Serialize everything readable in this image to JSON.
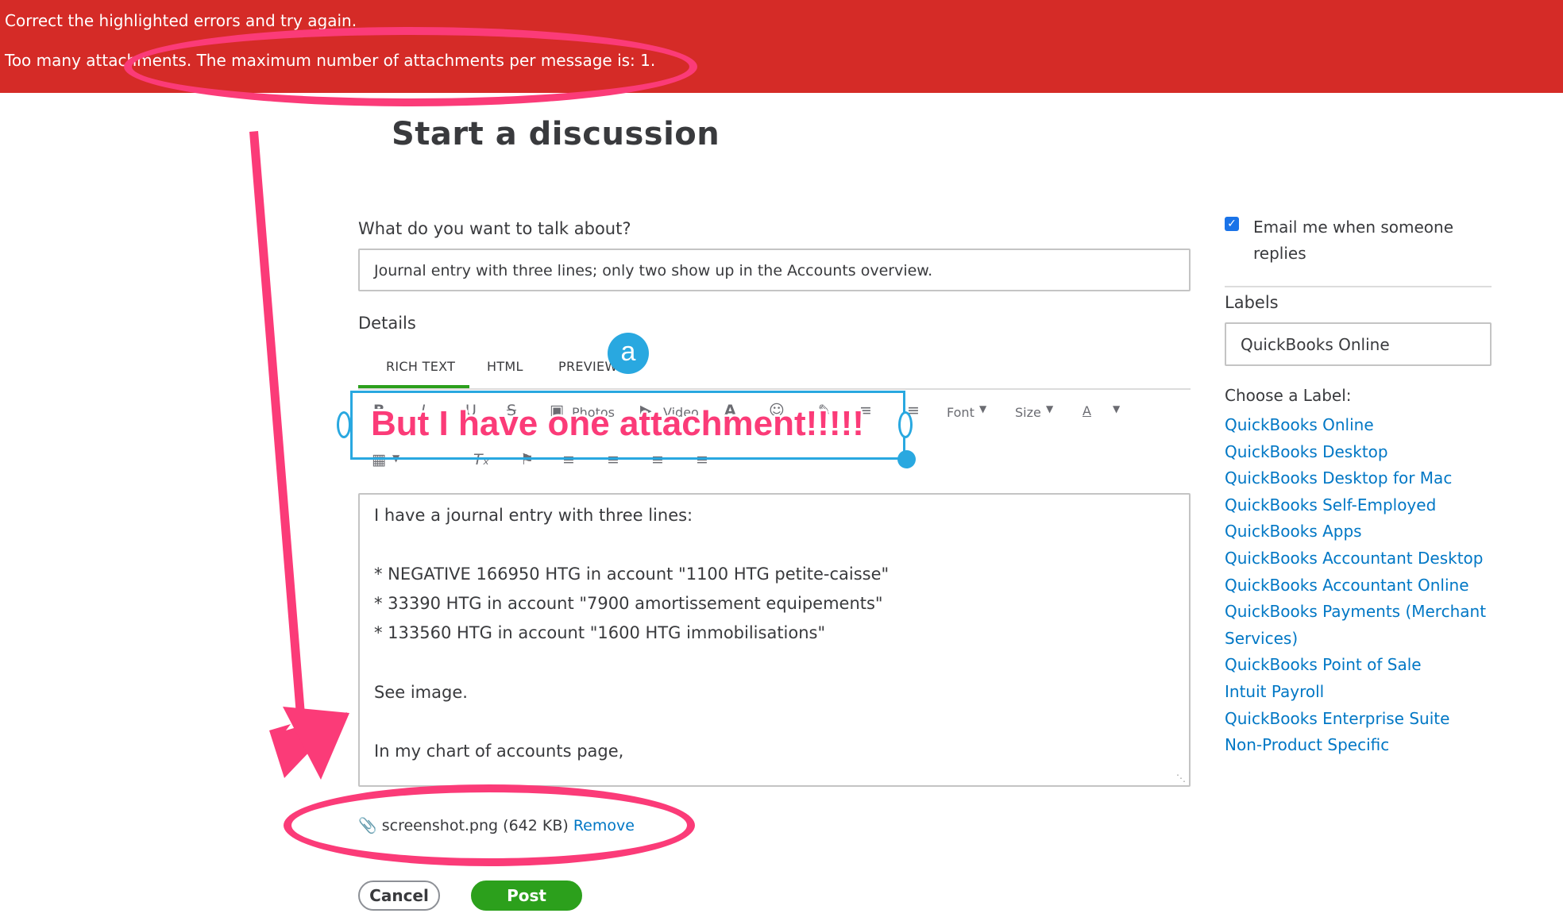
{
  "banner": {
    "line1": "Correct the highlighted errors and try again.",
    "line2": "Too many attachments. The maximum number of attachments per message is: 1."
  },
  "page": {
    "title": "Start a discussion"
  },
  "form": {
    "subject_label": "What do you want to talk about?",
    "subject_value": "Journal entry with three lines; only two show up in the Accounts overview.",
    "details_label": "Details",
    "tabs": [
      "RICH TEXT",
      "HTML",
      "PREVIEW"
    ],
    "active_tab": "RICH TEXT",
    "toolbar": {
      "photos_label": "Photos",
      "video_label": "Video",
      "font_label": "Font",
      "size_label": "Size",
      "color_label": "A"
    },
    "details_lines": [
      "I have a journal entry with three lines:",
      "* NEGATIVE 166950 HTG in account \"1100 HTG petite-caisse\"",
      "* 33390 HTG in account \"7900 amortissement equipements\"",
      "* 133560 HTG in account \"1600 HTG immobilisations\"",
      "See image.",
      "In my chart of accounts page,"
    ],
    "attachment": {
      "filename": "screenshot.png",
      "size": "(642 KB)",
      "remove_label": "Remove"
    },
    "cancel_label": "Cancel",
    "post_label": "Post"
  },
  "sidebar": {
    "email_checkbox_checked": true,
    "email_label_line1": "Email me when someone",
    "email_label_line2": "replies",
    "labels_heading": "Labels",
    "selected_label": "QuickBooks Online",
    "choose_heading": "Choose a Label:",
    "label_options": [
      "QuickBooks Online",
      "QuickBooks Desktop",
      "QuickBooks Desktop for Mac",
      "QuickBooks Self-Employed",
      "QuickBooks Apps",
      "QuickBooks Accountant Desktop",
      "QuickBooks Accountant Online",
      "QuickBooks Payments (Merchant",
      "Services)",
      "QuickBooks Point of Sale",
      "Intuit Payroll",
      "QuickBooks Enterprise Suite",
      "Non-Product Specific"
    ]
  },
  "annotations": {
    "callout_text": "But I have one attachment!!!!!",
    "badge_letter": "a",
    "color": "#fb3b78",
    "callout_color": "#29a8e0"
  },
  "colors": {
    "banner": "#d52b27",
    "link": "#0077c5",
    "accent_green": "#2ca01c"
  }
}
